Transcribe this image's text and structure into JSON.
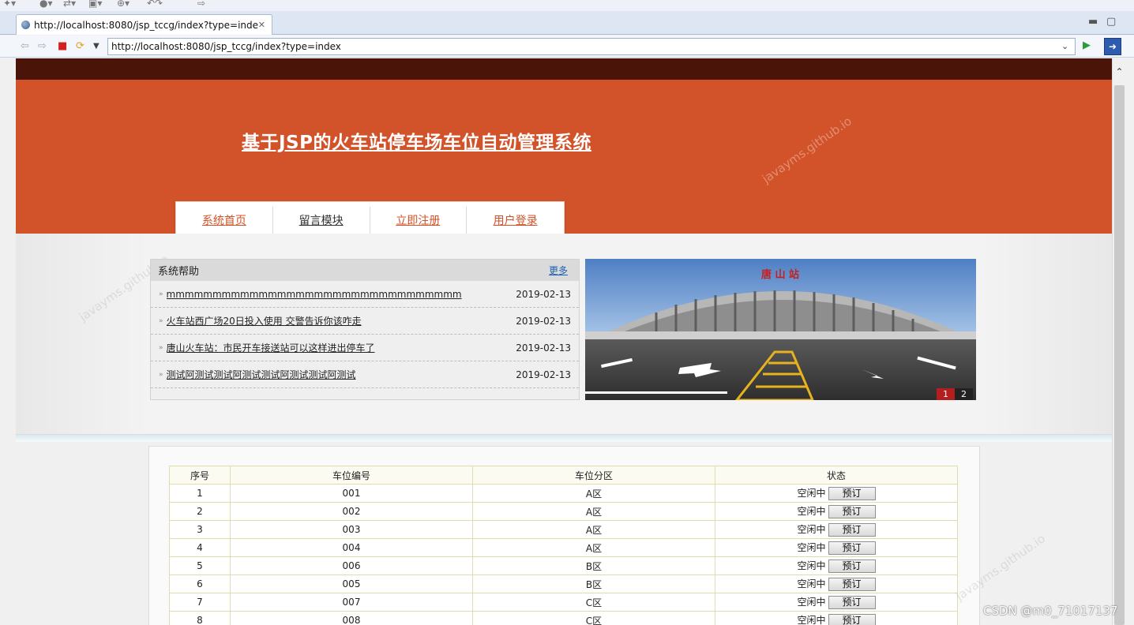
{
  "browser": {
    "tab_title": "http://localhost:8080/jsp_tccg/index?type=index",
    "url": "http://localhost:8080/jsp_tccg/index?type=index"
  },
  "site": {
    "title": "基于JSP的火车站停车场车位自动管理系统",
    "nav": [
      {
        "label": "系统首页"
      },
      {
        "label": "留言模块"
      },
      {
        "label": "立即注册"
      },
      {
        "label": "用户登录"
      }
    ]
  },
  "help": {
    "title": "系统帮助",
    "more": "更多",
    "items": [
      {
        "title": "mmmmmmmmmmmmmmmmmmmmmmmmmmmmmmmm",
        "date": "2019-02-13"
      },
      {
        "title": "火车站西广场20日投入使用 交警告诉你该咋走",
        "date": "2019-02-13"
      },
      {
        "title": "唐山火车站：市民开车接送站可以这样进出停车了",
        "date": "2019-02-13"
      },
      {
        "title": "测试阿测试测试阿测试测试阿测试测试阿测试",
        "date": "2019-02-13"
      }
    ]
  },
  "banner": {
    "sign": "唐 山 站",
    "dots": [
      "1",
      "2"
    ]
  },
  "table": {
    "headers": [
      "序号",
      "车位编号",
      "车位分区",
      "状态"
    ],
    "rows": [
      {
        "no": "1",
        "code": "001",
        "zone": "A区",
        "status": "空闲中",
        "action": "预订"
      },
      {
        "no": "2",
        "code": "002",
        "zone": "A区",
        "status": "空闲中",
        "action": "预订"
      },
      {
        "no": "3",
        "code": "003",
        "zone": "A区",
        "status": "空闲中",
        "action": "预订"
      },
      {
        "no": "4",
        "code": "004",
        "zone": "A区",
        "status": "空闲中",
        "action": "预订"
      },
      {
        "no": "5",
        "code": "006",
        "zone": "B区",
        "status": "空闲中",
        "action": "预订"
      },
      {
        "no": "6",
        "code": "005",
        "zone": "B区",
        "status": "空闲中",
        "action": "预订"
      },
      {
        "no": "7",
        "code": "007",
        "zone": "C区",
        "status": "空闲中",
        "action": "预订"
      },
      {
        "no": "8",
        "code": "008",
        "zone": "C区",
        "status": "空闲中",
        "action": "预订"
      }
    ]
  },
  "watermark": "javayms.github.io",
  "csdn_mark": "CSDN @m0_71017137",
  "colors": {
    "header": "#d25229",
    "top_strip": "#4a1508",
    "nav_active": "#d25229",
    "link": "#1f5fb5",
    "table_border": "#e0dcab"
  }
}
